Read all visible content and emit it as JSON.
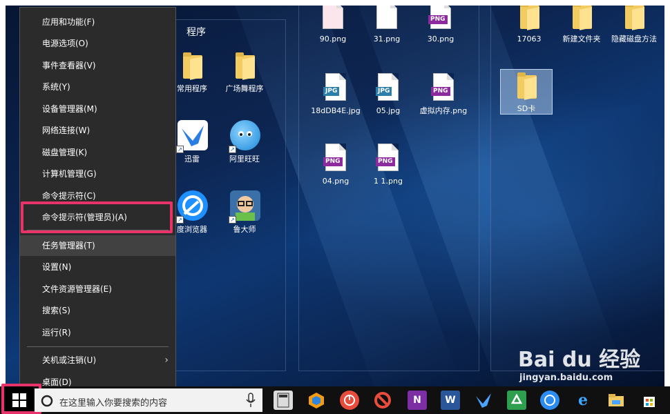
{
  "program_group": {
    "title": "程序"
  },
  "group_icons": [
    {
      "label": "常用程序"
    },
    {
      "label": "广场舞程序"
    },
    {
      "label": "迅雷"
    },
    {
      "label": "阿里旺旺"
    },
    {
      "label": "度浏览器"
    },
    {
      "label": "鲁大师"
    }
  ],
  "files": [
    {
      "label": "90.png"
    },
    {
      "label": "31.png"
    },
    {
      "label": "30.png",
      "badge": "PNG"
    },
    {
      "label": "18dDB4E.jpg",
      "badge": "JPG"
    },
    {
      "label": "05.jpg",
      "badge": "JPG"
    },
    {
      "label": "虚拟内存.png",
      "badge": "PNG"
    },
    {
      "label": "04.png",
      "badge": "PNG"
    },
    {
      "label": "1 1.png",
      "badge": "PNG"
    }
  ],
  "folders": [
    {
      "label": "17063"
    },
    {
      "label": "新建文件夹"
    },
    {
      "label": "隐藏磁盘方法"
    },
    {
      "label": "SD卡"
    }
  ],
  "menu": {
    "items": [
      {
        "label": "应用和功能(F)"
      },
      {
        "label": "电源选项(O)"
      },
      {
        "label": "事件查看器(V)"
      },
      {
        "label": "系统(Y)"
      },
      {
        "label": "设备管理器(M)"
      },
      {
        "label": "网络连接(W)"
      },
      {
        "label": "磁盘管理(K)"
      },
      {
        "label": "计算机管理(G)"
      },
      {
        "label": "命令提示符(C)"
      },
      {
        "label": "命令提示符(管理员)(A)"
      },
      {
        "label": "任务管理器(T)"
      },
      {
        "label": "设置(N)"
      },
      {
        "label": "文件资源管理器(E)"
      },
      {
        "label": "搜索(S)"
      },
      {
        "label": "运行(R)"
      },
      {
        "label": "关机或注销(U)"
      },
      {
        "label": "桌面(D)"
      }
    ],
    "submenu_arrow": "›"
  },
  "taskbar": {
    "search_placeholder": "在这里输入你要搜索的内容",
    "apps": [
      {
        "icon": "calculator-icon"
      },
      {
        "icon": "browser-icon"
      },
      {
        "icon": "power-icon"
      },
      {
        "icon": "block-icon"
      },
      {
        "icon": "onenote-icon",
        "text": "N"
      },
      {
        "icon": "word-icon",
        "text": "W"
      },
      {
        "icon": "thunder-icon"
      },
      {
        "icon": "recycle-icon"
      },
      {
        "icon": "baidu-browser-icon"
      },
      {
        "icon": "edge-icon",
        "text": "e"
      },
      {
        "icon": "file-explorer-icon"
      },
      {
        "icon": "store-icon"
      }
    ]
  },
  "watermark": {
    "logo": "Bai du 经验",
    "url": "jingyan.baidu.com"
  },
  "colors": {
    "highlight": "#e8336a",
    "menu_bg": "#2b2b2b",
    "menu_hover": "#414141"
  }
}
